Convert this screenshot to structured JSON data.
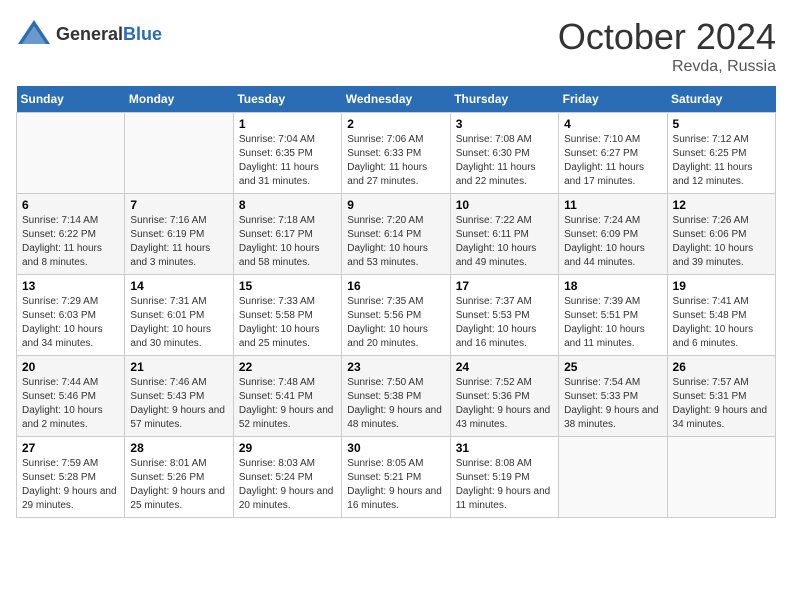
{
  "header": {
    "logo_general": "General",
    "logo_blue": "Blue",
    "title": "October 2024",
    "location": "Revda, Russia"
  },
  "weekdays": [
    "Sunday",
    "Monday",
    "Tuesday",
    "Wednesday",
    "Thursday",
    "Friday",
    "Saturday"
  ],
  "weeks": [
    [
      {
        "day": "",
        "sunrise": "",
        "sunset": "",
        "daylight": ""
      },
      {
        "day": "",
        "sunrise": "",
        "sunset": "",
        "daylight": ""
      },
      {
        "day": "1",
        "sunrise": "Sunrise: 7:04 AM",
        "sunset": "Sunset: 6:35 PM",
        "daylight": "Daylight: 11 hours and 31 minutes."
      },
      {
        "day": "2",
        "sunrise": "Sunrise: 7:06 AM",
        "sunset": "Sunset: 6:33 PM",
        "daylight": "Daylight: 11 hours and 27 minutes."
      },
      {
        "day": "3",
        "sunrise": "Sunrise: 7:08 AM",
        "sunset": "Sunset: 6:30 PM",
        "daylight": "Daylight: 11 hours and 22 minutes."
      },
      {
        "day": "4",
        "sunrise": "Sunrise: 7:10 AM",
        "sunset": "Sunset: 6:27 PM",
        "daylight": "Daylight: 11 hours and 17 minutes."
      },
      {
        "day": "5",
        "sunrise": "Sunrise: 7:12 AM",
        "sunset": "Sunset: 6:25 PM",
        "daylight": "Daylight: 11 hours and 12 minutes."
      }
    ],
    [
      {
        "day": "6",
        "sunrise": "Sunrise: 7:14 AM",
        "sunset": "Sunset: 6:22 PM",
        "daylight": "Daylight: 11 hours and 8 minutes."
      },
      {
        "day": "7",
        "sunrise": "Sunrise: 7:16 AM",
        "sunset": "Sunset: 6:19 PM",
        "daylight": "Daylight: 11 hours and 3 minutes."
      },
      {
        "day": "8",
        "sunrise": "Sunrise: 7:18 AM",
        "sunset": "Sunset: 6:17 PM",
        "daylight": "Daylight: 10 hours and 58 minutes."
      },
      {
        "day": "9",
        "sunrise": "Sunrise: 7:20 AM",
        "sunset": "Sunset: 6:14 PM",
        "daylight": "Daylight: 10 hours and 53 minutes."
      },
      {
        "day": "10",
        "sunrise": "Sunrise: 7:22 AM",
        "sunset": "Sunset: 6:11 PM",
        "daylight": "Daylight: 10 hours and 49 minutes."
      },
      {
        "day": "11",
        "sunrise": "Sunrise: 7:24 AM",
        "sunset": "Sunset: 6:09 PM",
        "daylight": "Daylight: 10 hours and 44 minutes."
      },
      {
        "day": "12",
        "sunrise": "Sunrise: 7:26 AM",
        "sunset": "Sunset: 6:06 PM",
        "daylight": "Daylight: 10 hours and 39 minutes."
      }
    ],
    [
      {
        "day": "13",
        "sunrise": "Sunrise: 7:29 AM",
        "sunset": "Sunset: 6:03 PM",
        "daylight": "Daylight: 10 hours and 34 minutes."
      },
      {
        "day": "14",
        "sunrise": "Sunrise: 7:31 AM",
        "sunset": "Sunset: 6:01 PM",
        "daylight": "Daylight: 10 hours and 30 minutes."
      },
      {
        "day": "15",
        "sunrise": "Sunrise: 7:33 AM",
        "sunset": "Sunset: 5:58 PM",
        "daylight": "Daylight: 10 hours and 25 minutes."
      },
      {
        "day": "16",
        "sunrise": "Sunrise: 7:35 AM",
        "sunset": "Sunset: 5:56 PM",
        "daylight": "Daylight: 10 hours and 20 minutes."
      },
      {
        "day": "17",
        "sunrise": "Sunrise: 7:37 AM",
        "sunset": "Sunset: 5:53 PM",
        "daylight": "Daylight: 10 hours and 16 minutes."
      },
      {
        "day": "18",
        "sunrise": "Sunrise: 7:39 AM",
        "sunset": "Sunset: 5:51 PM",
        "daylight": "Daylight: 10 hours and 11 minutes."
      },
      {
        "day": "19",
        "sunrise": "Sunrise: 7:41 AM",
        "sunset": "Sunset: 5:48 PM",
        "daylight": "Daylight: 10 hours and 6 minutes."
      }
    ],
    [
      {
        "day": "20",
        "sunrise": "Sunrise: 7:44 AM",
        "sunset": "Sunset: 5:46 PM",
        "daylight": "Daylight: 10 hours and 2 minutes."
      },
      {
        "day": "21",
        "sunrise": "Sunrise: 7:46 AM",
        "sunset": "Sunset: 5:43 PM",
        "daylight": "Daylight: 9 hours and 57 minutes."
      },
      {
        "day": "22",
        "sunrise": "Sunrise: 7:48 AM",
        "sunset": "Sunset: 5:41 PM",
        "daylight": "Daylight: 9 hours and 52 minutes."
      },
      {
        "day": "23",
        "sunrise": "Sunrise: 7:50 AM",
        "sunset": "Sunset: 5:38 PM",
        "daylight": "Daylight: 9 hours and 48 minutes."
      },
      {
        "day": "24",
        "sunrise": "Sunrise: 7:52 AM",
        "sunset": "Sunset: 5:36 PM",
        "daylight": "Daylight: 9 hours and 43 minutes."
      },
      {
        "day": "25",
        "sunrise": "Sunrise: 7:54 AM",
        "sunset": "Sunset: 5:33 PM",
        "daylight": "Daylight: 9 hours and 38 minutes."
      },
      {
        "day": "26",
        "sunrise": "Sunrise: 7:57 AM",
        "sunset": "Sunset: 5:31 PM",
        "daylight": "Daylight: 9 hours and 34 minutes."
      }
    ],
    [
      {
        "day": "27",
        "sunrise": "Sunrise: 7:59 AM",
        "sunset": "Sunset: 5:28 PM",
        "daylight": "Daylight: 9 hours and 29 minutes."
      },
      {
        "day": "28",
        "sunrise": "Sunrise: 8:01 AM",
        "sunset": "Sunset: 5:26 PM",
        "daylight": "Daylight: 9 hours and 25 minutes."
      },
      {
        "day": "29",
        "sunrise": "Sunrise: 8:03 AM",
        "sunset": "Sunset: 5:24 PM",
        "daylight": "Daylight: 9 hours and 20 minutes."
      },
      {
        "day": "30",
        "sunrise": "Sunrise: 8:05 AM",
        "sunset": "Sunset: 5:21 PM",
        "daylight": "Daylight: 9 hours and 16 minutes."
      },
      {
        "day": "31",
        "sunrise": "Sunrise: 8:08 AM",
        "sunset": "Sunset: 5:19 PM",
        "daylight": "Daylight: 9 hours and 11 minutes."
      },
      {
        "day": "",
        "sunrise": "",
        "sunset": "",
        "daylight": ""
      },
      {
        "day": "",
        "sunrise": "",
        "sunset": "",
        "daylight": ""
      }
    ]
  ]
}
